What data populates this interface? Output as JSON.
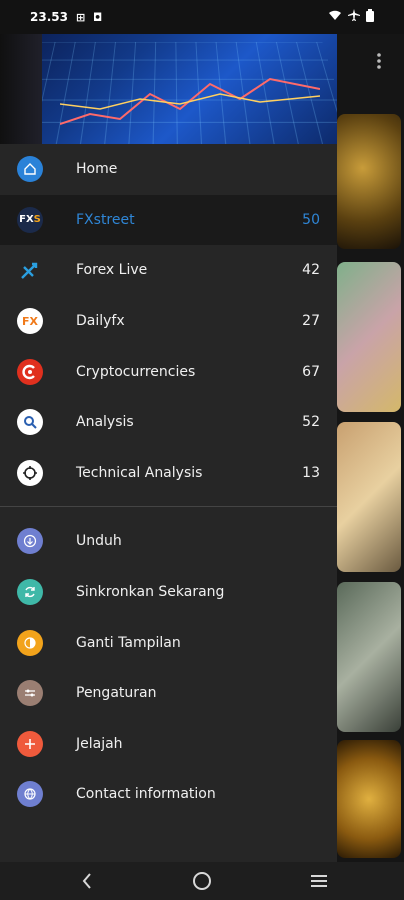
{
  "status_bar": {
    "time": "23.53",
    "left_icons": "⊞ ◘",
    "right_icons": [
      "wifi-icon",
      "airplane-icon",
      "battery-icon"
    ]
  },
  "feeds": [
    {
      "label": "Home",
      "count": "",
      "icon": "home-icon",
      "color": "#2a82d8"
    },
    {
      "label": "FXstreet",
      "count": "50",
      "icon": "fxstreet-logo",
      "color": "#1b2a4a",
      "active": true
    },
    {
      "label": "Forex Live",
      "count": "42",
      "icon": "forexlive-logo",
      "color": "#2a82d8"
    },
    {
      "label": "Dailyfx",
      "count": "27",
      "icon": "dailyfx-logo",
      "color": "#ffffff"
    },
    {
      "label": "Cryptocurrencies",
      "count": "67",
      "icon": "crypto-logo",
      "color": "#e0301e"
    },
    {
      "label": "Analysis",
      "count": "52",
      "icon": "analysis-logo",
      "color": "#ffffff"
    },
    {
      "label": "Technical Analysis",
      "count": "13",
      "icon": "technical-analysis-logo",
      "color": "#ffffff"
    }
  ],
  "actions": [
    {
      "label": "Unduh",
      "icon": "download-icon",
      "color": "#6f7fd0"
    },
    {
      "label": "Sinkronkan Sekarang",
      "icon": "sync-icon",
      "color": "#3fb8a8"
    },
    {
      "label": "Ganti Tampilan",
      "icon": "theme-icon",
      "color": "#f2a31b"
    },
    {
      "label": "Pengaturan",
      "icon": "settings-icon",
      "color": "#9a7e72"
    },
    {
      "label": "Jelajah",
      "icon": "explore-icon",
      "color": "#ef5a3c"
    },
    {
      "label": "Contact information",
      "icon": "contact-icon",
      "color": "#6f7fd0"
    }
  ],
  "navbar": {
    "back": "back-icon",
    "home": "home-nav-icon",
    "recents": "menu-icon"
  },
  "colors": {
    "accent": "#2f86d6",
    "drawer_bg": "#262626"
  }
}
